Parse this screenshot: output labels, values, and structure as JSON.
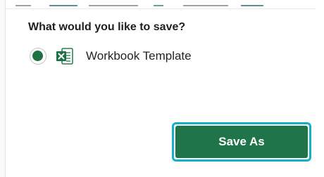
{
  "dialog": {
    "question": "What would you like to save?",
    "options": [
      {
        "label": "Workbook Template",
        "selected": true,
        "icon": "excel-file-icon"
      }
    ],
    "primary_button": "Save As"
  },
  "colors": {
    "accent": "#20744a",
    "radio_selected": "#1e7145",
    "focus_ring": "#14b0c9"
  }
}
